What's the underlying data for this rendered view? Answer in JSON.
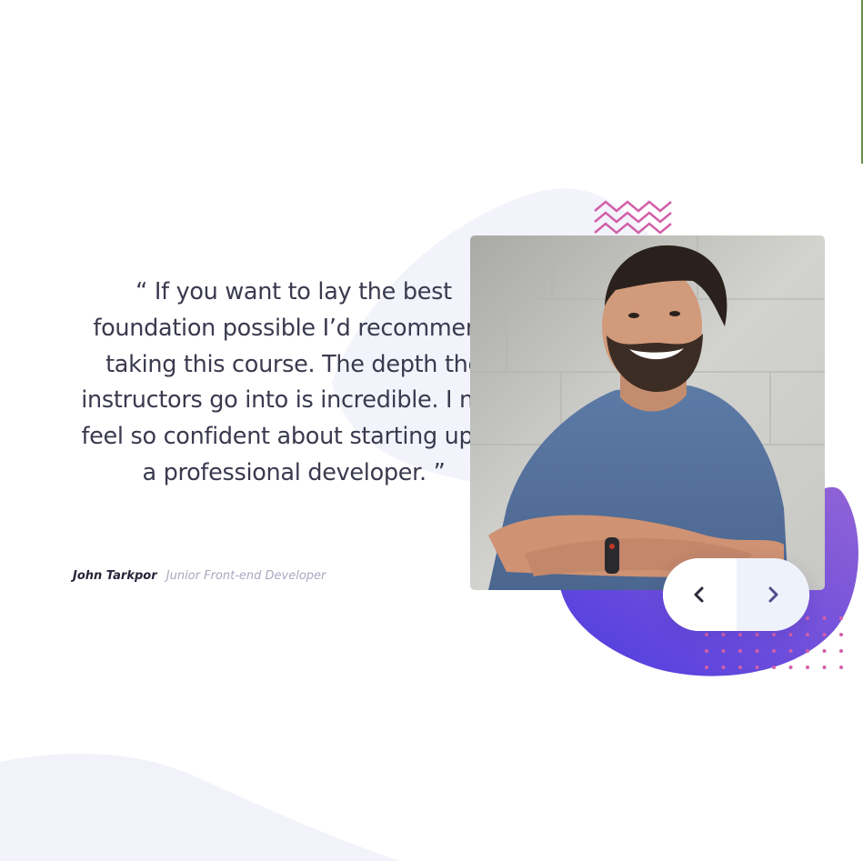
{
  "testimonial": {
    "quote": "“ If you want to lay the best foundation possible I’d recommend taking this course. The depth the instructors go into is incredible. I now feel so confident about starting up as a professional developer. ”",
    "author_name": "John Tarkpor",
    "author_role": "Junior Front-end Developer"
  },
  "slider": {
    "prev_icon": "chevron-left-icon",
    "next_icon": "chevron-right-icon"
  },
  "colors": {
    "text": "#3a3a4f",
    "muted": "#a8a8c2",
    "accent_purple": "#6644e0",
    "accent_violet": "#8a63d2",
    "pattern_pink": "#d25fa8",
    "background_blob": "#f2f2fb",
    "next_button_bg": "#eef3fb"
  }
}
